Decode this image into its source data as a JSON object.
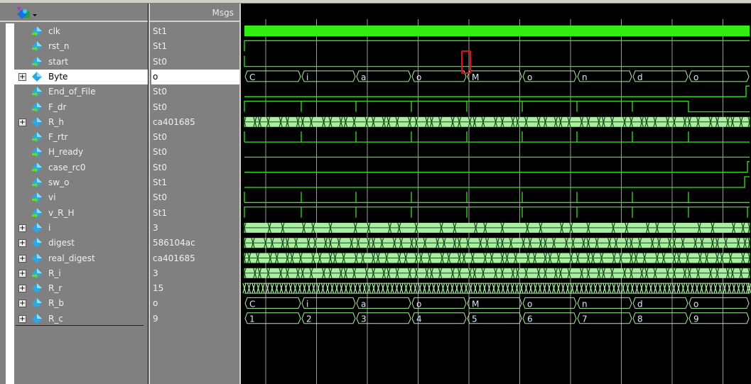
{
  "header": {
    "msgs_label": "Msgs"
  },
  "signals": [
    {
      "name": "clk",
      "value": "St1",
      "kind": "clock",
      "expandable": false
    },
    {
      "name": "rst_n",
      "value": "St1",
      "kind": "bit",
      "expandable": false
    },
    {
      "name": "start",
      "value": "St0",
      "kind": "bit",
      "expandable": false
    },
    {
      "name": "Byte",
      "value": "o",
      "kind": "bus",
      "expandable": true,
      "selected": true,
      "segments": [
        "C",
        "i",
        "a",
        "o",
        "M",
        "o",
        "n",
        "d",
        "o"
      ]
    },
    {
      "name": "End_of_File",
      "value": "St0",
      "kind": "bit",
      "expandable": false
    },
    {
      "name": "F_dr",
      "value": "St0",
      "kind": "bit",
      "expandable": false
    },
    {
      "name": "R_h",
      "value": "ca401685",
      "kind": "dense",
      "expandable": true
    },
    {
      "name": "F_rtr",
      "value": "St0",
      "kind": "bit",
      "expandable": false
    },
    {
      "name": "H_ready",
      "value": "St0",
      "kind": "bit",
      "expandable": false
    },
    {
      "name": "case_rc0",
      "value": "St0",
      "kind": "bit",
      "expandable": false
    },
    {
      "name": "sw_o",
      "value": "St1",
      "kind": "bit",
      "expandable": false
    },
    {
      "name": "vi",
      "value": "St0",
      "kind": "bit",
      "expandable": false
    },
    {
      "name": "v_R_H",
      "value": "St1",
      "kind": "bit",
      "expandable": false
    },
    {
      "name": "i",
      "value": "3",
      "kind": "dense",
      "expandable": true
    },
    {
      "name": "digest",
      "value": "586104ac",
      "kind": "dense",
      "expandable": true
    },
    {
      "name": "real_digest",
      "value": "ca401685",
      "kind": "dense",
      "expandable": true
    },
    {
      "name": "R_i",
      "value": "3",
      "kind": "dense",
      "expandable": true
    },
    {
      "name": "R_r",
      "value": "15",
      "kind": "vdense",
      "expandable": true
    },
    {
      "name": "R_b",
      "value": "o",
      "kind": "bus",
      "expandable": true,
      "segments": [
        "C",
        "i",
        "a",
        "o",
        "M",
        "o",
        "n",
        "d",
        "o"
      ]
    },
    {
      "name": "R_c",
      "value": "9",
      "kind": "bus",
      "expandable": true,
      "segments": [
        "1",
        "2",
        "3",
        "4",
        "5",
        "6",
        "7",
        "8",
        "9"
      ]
    }
  ],
  "colors": {
    "wave": "#3adf22",
    "bus": "#a8f0a0",
    "clock": "#33ee11",
    "cursor": "#e01010",
    "grid": "#9a9a9a"
  }
}
